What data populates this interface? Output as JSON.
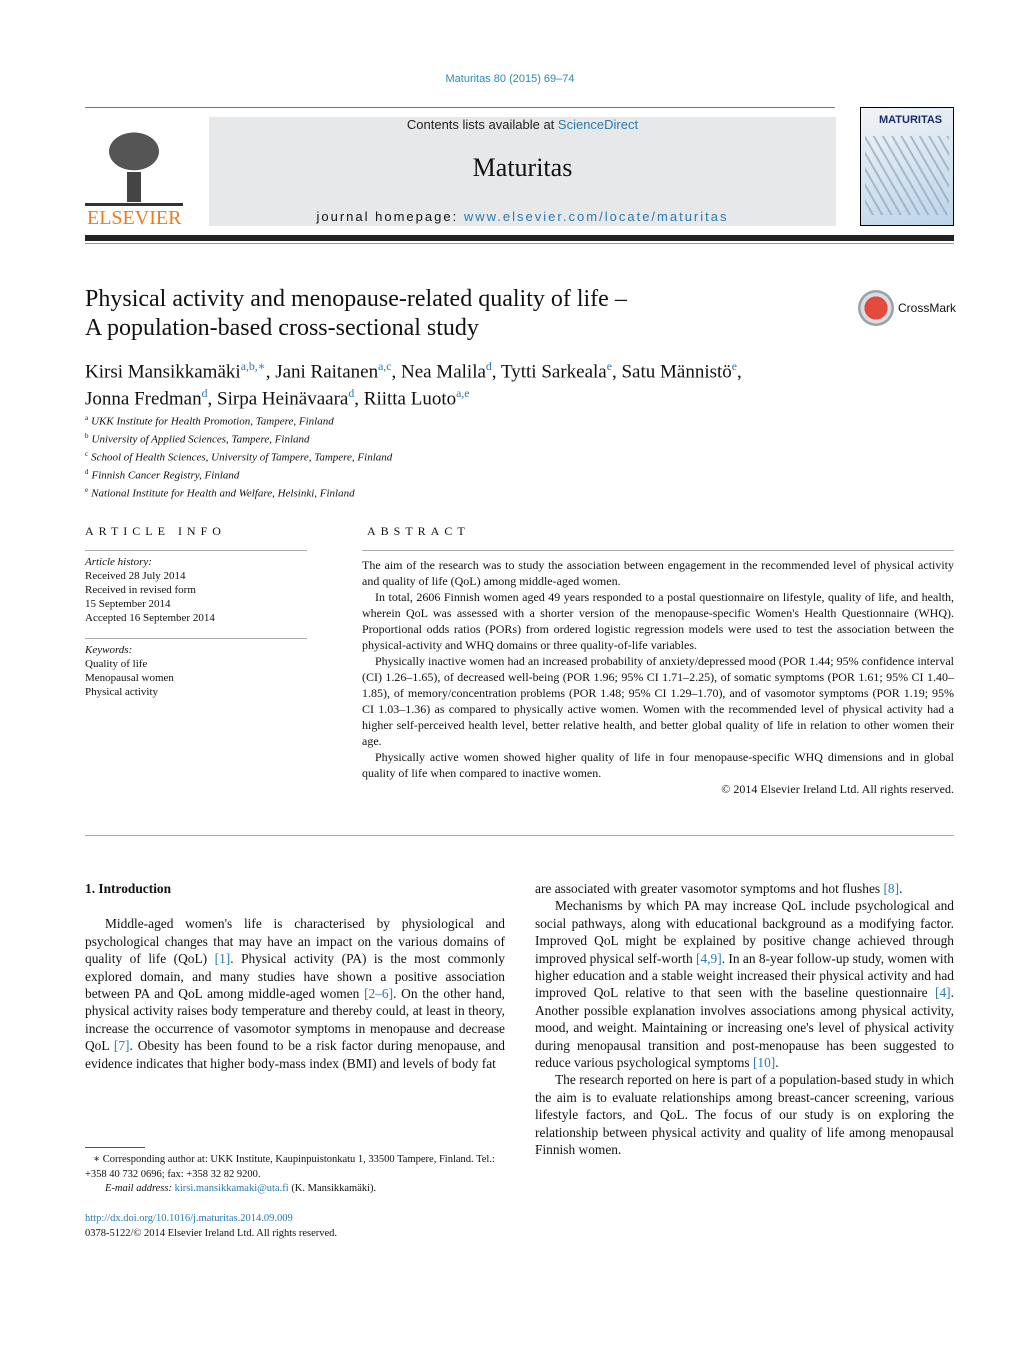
{
  "header": {
    "citation": "Maturitas 80 (2015) 69–74",
    "contents_prefix": "Contents lists available at ",
    "contents_link": "ScienceDirect",
    "journal_name": "Maturitas",
    "homepage_prefix": "journal homepage: ",
    "homepage_link": "www.elsevier.com/locate/maturitas",
    "publisher_logo": "ELSEVIER",
    "cover_title": "MATURITAS",
    "crossmark": "CrossMark"
  },
  "article": {
    "title_line1": "Physical activity and menopause-related quality of life –",
    "title_line2": "A population-based cross-sectional study",
    "authors": [
      {
        "name": "Kirsi Mansikkamäki",
        "sup": "a,b,∗",
        "sep": ", "
      },
      {
        "name": "Jani Raitanen",
        "sup": "a,c",
        "sep": ", "
      },
      {
        "name": "Nea Malila",
        "sup": "d",
        "sep": ", "
      },
      {
        "name": "Tytti Sarkeala",
        "sup": "e",
        "sep": ", "
      },
      {
        "name": "Satu Männistö",
        "sup": "e",
        "sep": ","
      },
      {
        "name": "Jonna Fredman",
        "sup": "d",
        "sep": ", "
      },
      {
        "name": "Sirpa Heinävaara",
        "sup": "d",
        "sep": ", "
      },
      {
        "name": "Riitta Luoto",
        "sup": "a,e",
        "sep": ""
      }
    ],
    "affiliations": [
      {
        "key": "a",
        "text": "UKK Institute for Health Promotion, Tampere, Finland"
      },
      {
        "key": "b",
        "text": "University of Applied Sciences, Tampere, Finland"
      },
      {
        "key": "c",
        "text": "School of Health Sciences, University of Tampere, Tampere, Finland"
      },
      {
        "key": "d",
        "text": "Finnish Cancer Registry, Finland"
      },
      {
        "key": "e",
        "text": "National Institute for Health and Welfare, Helsinki, Finland"
      }
    ]
  },
  "article_info": {
    "heading": "ARTICLE INFO",
    "history_label": "Article history:",
    "history": [
      "Received 28 July 2014",
      "Received in revised form",
      "15 September 2014",
      "Accepted 16 September 2014"
    ],
    "keywords_label": "Keywords:",
    "keywords": [
      "Quality of life",
      "Menopausal women",
      "Physical activity"
    ]
  },
  "abstract": {
    "heading": "ABSTRACT",
    "paragraphs": [
      "The aim of the research was to study the association between engagement in the recommended level of physical activity and quality of life (QoL) among middle-aged women.",
      "In total, 2606 Finnish women aged 49 years responded to a postal questionnaire on lifestyle, quality of life, and health, wherein QoL was assessed with a shorter version of the menopause-specific Women's Health Questionnaire (WHQ). Proportional odds ratios (PORs) from ordered logistic regression models were used to test the association between the physical-activity and WHQ domains or three quality-of-life variables.",
      "Physically inactive women had an increased probability of anxiety/depressed mood (POR 1.44; 95% confidence interval (CI) 1.26–1.65), of decreased well-being (POR 1.96; 95% CI 1.71–2.25), of somatic symptoms (POR 1.61; 95% CI 1.40–1.85), of memory/concentration problems (POR 1.48; 95% CI 1.29–1.70), and of vasomotor symptoms (POR 1.19; 95% CI 1.03–1.36) as compared to physically active women. Women with the recommended level of physical activity had a higher self-perceived health level, better relative health, and better global quality of life in relation to other women their age.",
      "Physically active women showed higher quality of life in four menopause-specific WHQ dimensions and in global quality of life when compared to inactive women."
    ],
    "copyright": "© 2014 Elsevier Ireland Ltd. All rights reserved."
  },
  "body": {
    "intro_heading": "1.  Introduction",
    "col1_paragraphs": [
      [
        [
          "Middle-aged women's life is characterised by physiological and psychological changes that may have an impact on the various domains of quality of life (QoL) ",
          0
        ],
        [
          "[1]",
          1
        ],
        [
          ". Physical activity (PA) is the most commonly explored domain, and many studies have shown a positive association between PA and QoL among middle-aged women ",
          0
        ],
        [
          "[2–6]",
          1
        ],
        [
          ". On the other hand, physical activity raises body temperature and thereby could, at least in theory, increase the occurrence of vasomotor symptoms in menopause and decrease QoL ",
          0
        ],
        [
          "[7]",
          1
        ],
        [
          ". Obesity has been found to be a risk factor during menopause, and evidence indicates that higher body-mass index (BMI) and levels of body fat",
          0
        ]
      ]
    ],
    "col2_paragraphs": [
      [
        [
          "are associated with greater vasomotor symptoms and hot flushes ",
          0
        ],
        [
          "[8]",
          1
        ],
        [
          ".",
          0
        ]
      ],
      [
        [
          "Mechanisms by which PA may increase QoL include psychological and social pathways, along with educational background as a modifying factor. Improved QoL might be explained by positive change achieved through improved physical self-worth ",
          0
        ],
        [
          "[4,9]",
          1
        ],
        [
          ". In an 8-year follow-up study, women with higher education and a stable weight increased their physical activity and had improved QoL relative to that seen with the baseline questionnaire ",
          0
        ],
        [
          "[4]",
          1
        ],
        [
          ". Another possible explanation involves associations among physical activity, mood, and weight. Maintaining or increasing one's level of physical activity during menopausal transition and post-menopause has been suggested to reduce various psychological symptoms ",
          0
        ],
        [
          "[10]",
          1
        ],
        [
          ".",
          0
        ]
      ],
      [
        [
          "The research reported on here is part of a population-based study in which the aim is to evaluate relationships among breast-cancer screening, various lifestyle factors, and QoL. The focus of our study is on exploring the relationship between physical activity and quality of life among menopausal Finnish women.",
          0
        ]
      ]
    ]
  },
  "footnote": {
    "text": "∗  Corresponding author at: UKK Institute, Kaupinpuistonkatu 1, 33500 Tampere, Finland. Tel.: +358 40 732 0696; fax: +358 32 82 9200.",
    "email_label": "E-mail address: ",
    "email": "kirsi.mansikkamaki@uta.fi",
    "email_suffix": " (K. Mansikkamäki)."
  },
  "doi": {
    "link": "http://dx.doi.org/10.1016/j.maturitas.2014.09.009",
    "issn": "0378-5122/© 2014 Elsevier Ireland Ltd. All rights reserved."
  },
  "colors": {
    "link": "#2a7ab0",
    "publisher_orange": "#f07a1a",
    "masthead_bg": "#e7e8ea"
  }
}
